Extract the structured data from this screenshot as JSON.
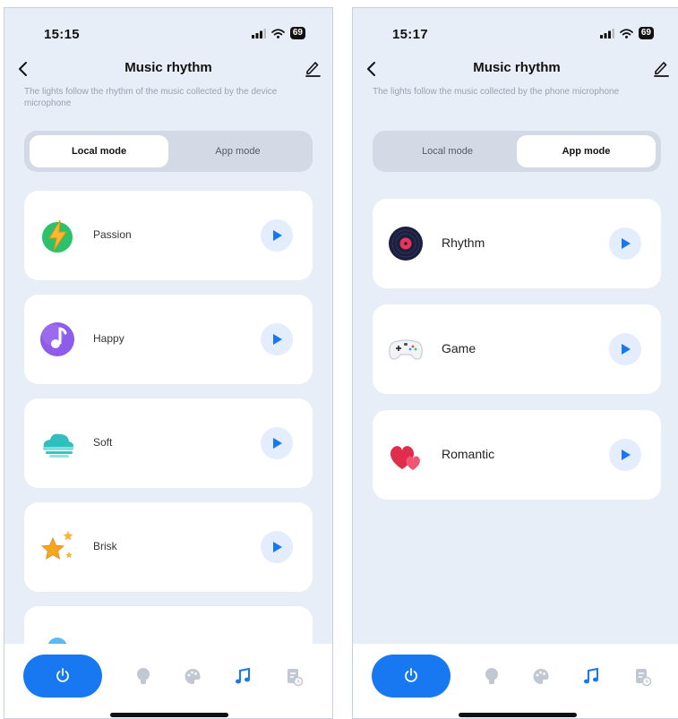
{
  "screens": [
    {
      "status": {
        "time": "15:15",
        "battery": "69"
      },
      "nav": {
        "title": "Music rhythm"
      },
      "description": "The lights follow the rhythm of the music collected by the device microphone",
      "modes": {
        "local": "Local mode",
        "app": "App mode",
        "active": "local"
      },
      "items": [
        {
          "label": "Passion",
          "icon": "lightning-icon"
        },
        {
          "label": "Happy",
          "icon": "music-note-icon"
        },
        {
          "label": "Soft",
          "icon": "cloud-icon"
        },
        {
          "label": "Brisk",
          "icon": "stars-icon"
        }
      ]
    },
    {
      "status": {
        "time": "15:17",
        "battery": "69"
      },
      "nav": {
        "title": "Music rhythm"
      },
      "description": "The lights follow the music collected by the phone microphone",
      "modes": {
        "local": "Local mode",
        "app": "App mode",
        "active": "app"
      },
      "items": [
        {
          "label": "Rhythm",
          "icon": "vinyl-record-icon"
        },
        {
          "label": "Game",
          "icon": "gamepad-icon"
        },
        {
          "label": "Romantic",
          "icon": "hearts-icon"
        }
      ]
    }
  ],
  "tabbar": {
    "items": [
      "power-icon",
      "bulb-icon",
      "palette-icon",
      "music-icon",
      "schedule-icon"
    ],
    "active": "music-icon"
  },
  "colors": {
    "accent": "#1778f2",
    "background": "#e8eef8",
    "card": "#ffffff",
    "play_button_bg": "#e3edfb",
    "inactive_icon": "#c2c8d1"
  }
}
